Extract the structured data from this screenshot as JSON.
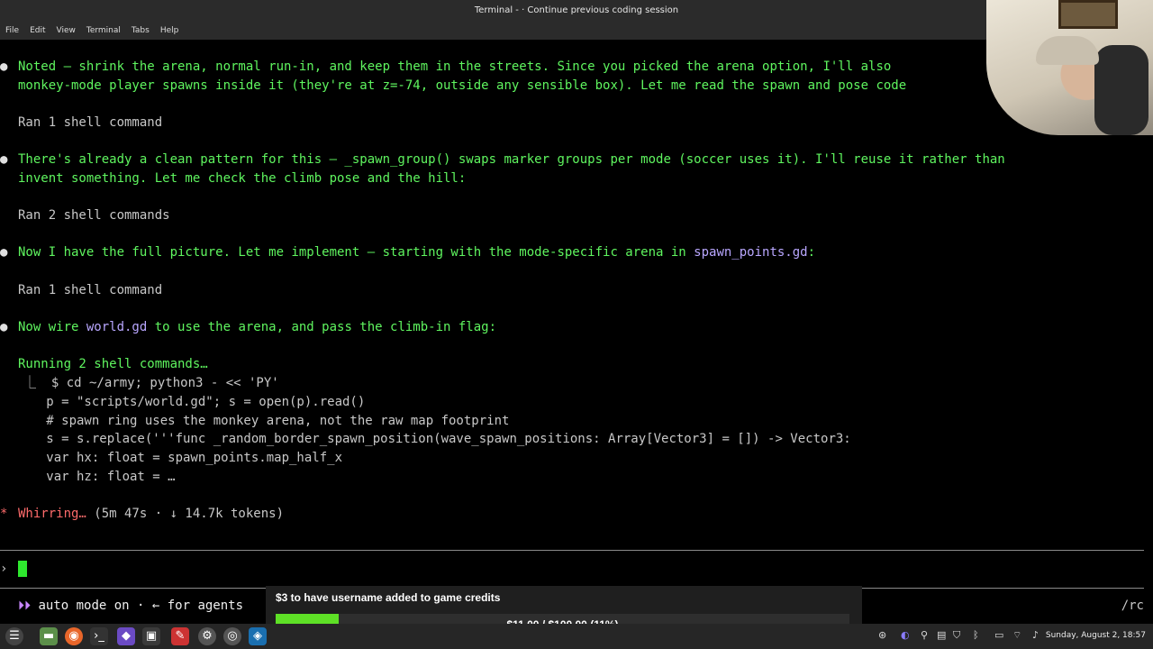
{
  "window": {
    "title": "Terminal -  · Continue previous coding session"
  },
  "menu": [
    "File",
    "Edit",
    "View",
    "Terminal",
    "Tabs",
    "Help"
  ],
  "transcript": {
    "b1_l1": "Noted — shrink the arena, normal run-in, and keep them in the streets. Since you picked the arena option, I'll also",
    "b1_l2": "monkey-mode player spawns inside it (they're at z=-74, outside any sensible box). Let me read the spawn and pose code",
    "ran1": "Ran 1 shell command",
    "b2_l1": "There's already a clean pattern for this — _spawn_group() swaps marker groups per mode (soccer uses it). I'll reuse it rather than",
    "b2_l2": "invent something. Let me check the climb pose and the hill:",
    "ran2": "Ran 2 shell commands",
    "b3_pre": "Now I have the full picture. Let me implement — starting with the mode-specific arena in ",
    "b3_file": "spawn_points.gd",
    "b3_post": ":",
    "ran3": "Ran 1 shell command",
    "b4_pre": "Now wire ",
    "b4_file": "world.gd",
    "b4_post": " to use the arena, and pass the climb-in flag:",
    "running": "Running 2 shell commands…",
    "cmd": [
      "⎿  $ cd ~/army; python3 - << 'PY'",
      "   p = \"scripts/world.gd\"; s = open(p).read()",
      "   # spawn ring uses the monkey arena, not the raw map footprint",
      "   s = s.replace('''func _random_border_spawn_position(wave_spawn_positions: Array[Vector3] = []) -> Vector3:",
      "   var hx: float = spawn_points.map_half_x",
      "   var hz: float = …"
    ],
    "status_word": "Whirring…",
    "status_rest": " (5m 47s · ↓ 14.7k tokens)"
  },
  "prompt": {
    "symbol": "›"
  },
  "footer": {
    "auto_mode": "auto mode on · ← for agents",
    "right": "/rc"
  },
  "overlay": {
    "title": "$3 to have username added to game credits",
    "bar_text": "$11.00 / $100.00 (11%)",
    "progress": 0.11
  },
  "taskbar": {
    "clock": "Sunday, August  2, 18:57"
  },
  "colors": {
    "green": "#5ff55f",
    "purple": "#b9a7ff",
    "progress": "#5ee026"
  }
}
